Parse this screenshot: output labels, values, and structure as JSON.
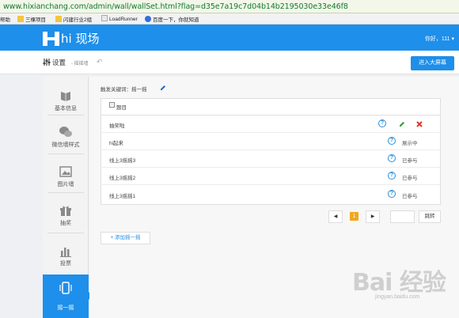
{
  "browser": {
    "url": "www.hixianchang.com/admin/wall/wallSet.html?flag=d35e7a19c7d04b14b2195030e33e46f8",
    "bookmarks": [
      "帮助",
      "三棵项目",
      "闪建行业2组",
      "LoadRunner",
      "百度一下，你就知道"
    ]
  },
  "header": {
    "logo_text": "hi 现场",
    "greeting": "你好，111 ▾"
  },
  "subheader": {
    "title": "设置",
    "subtitle": "- 摇摇墙",
    "back_symbol": "↶",
    "big_screen_button": "进入大屏幕"
  },
  "sidebar": {
    "items": [
      {
        "label": "基本信息",
        "icon": "book-icon",
        "active": false
      },
      {
        "label": "微信墙样式",
        "icon": "wechat-icon",
        "active": false
      },
      {
        "label": "图片墙",
        "icon": "image-icon",
        "active": false
      },
      {
        "label": "抽奖",
        "icon": "gift-icon",
        "active": false
      },
      {
        "label": "投票",
        "icon": "bar-chart-icon",
        "active": false
      },
      {
        "label": "摇一摇",
        "icon": "phone-shake-icon",
        "active": true
      }
    ]
  },
  "content": {
    "keyword_label": "触发关键词：摇一摇",
    "table_title": "题目",
    "rows": [
      {
        "name": "抽奖啦",
        "status": ""
      },
      {
        "name": "hi起来",
        "status": "展示中"
      },
      {
        "name": "线上3摇摇3",
        "status": "已参与"
      },
      {
        "name": "线上3摇摇2",
        "status": "已参与"
      },
      {
        "name": "线上3摇摇1",
        "status": "已参与"
      }
    ],
    "pagination": {
      "prev": "◀",
      "current": "1",
      "next": "▶",
      "go_label": "跳转"
    },
    "add_button": "+ 添加摇一摇"
  },
  "watermark": {
    "main": "Bai 经验",
    "sub": "jingyan.baidu.com"
  },
  "colors": {
    "brand_blue": "#1e8fea",
    "page_current": "#f1a81e",
    "delete_red": "#e0362c",
    "edit_green": "#2e9e3c"
  }
}
